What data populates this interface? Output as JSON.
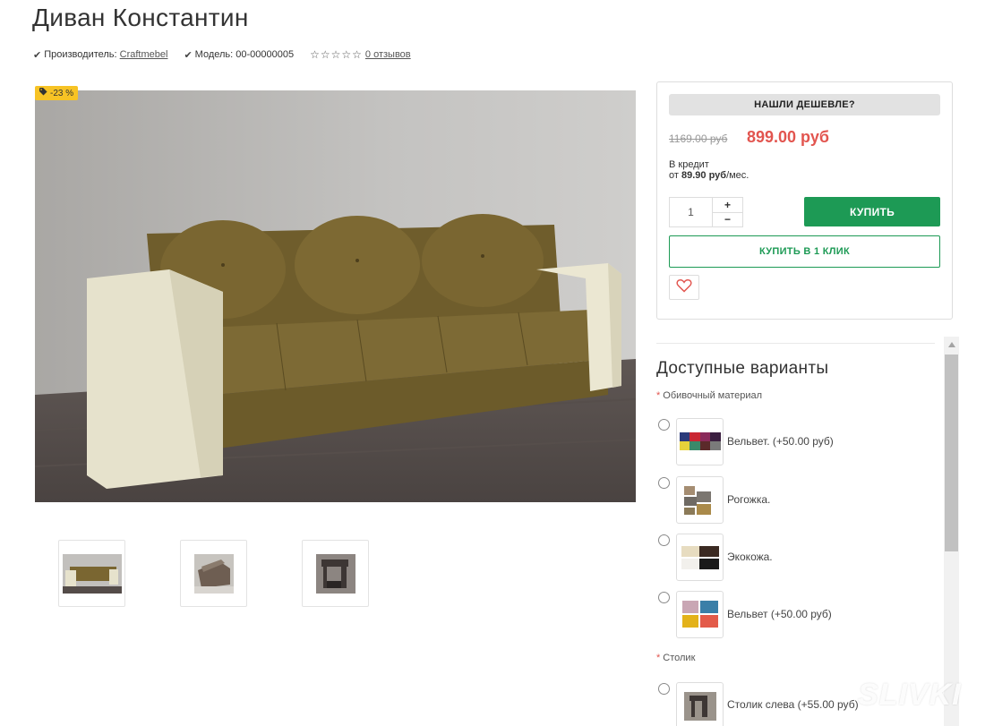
{
  "product": {
    "title": "Диван Константин",
    "manufacturer_label": "Производитель:",
    "manufacturer": "Craftmebel",
    "model_label": "Модель:",
    "model": "00-00000005",
    "rating": 0,
    "reviews_link": "0 отзывов"
  },
  "badge": {
    "text": "-23 %",
    "color": "#f7c325"
  },
  "buybox": {
    "cheaper_label": "НАШЛИ ДЕШЕВЛЕ?",
    "old_price": "1169.00 руб",
    "new_price": "899.00 руб",
    "credit_line1": "В кредит",
    "credit_prefix": "от",
    "credit_amount": "89.90 руб",
    "credit_suffix": "/мес.",
    "quantity": "1",
    "qty_plus": "+",
    "qty_minus": "−",
    "buy_label": "КУПИТЬ",
    "oneclick_label": "КУПИТЬ В 1 КЛИК",
    "accent_green": "#1d9a55",
    "price_red": "#e2554f"
  },
  "variants": {
    "title": "Доступные варианты",
    "groups": [
      {
        "label": "Обивочный материал",
        "options": [
          {
            "label": "Вельвет. (+50.00 руб)",
            "icon": "velvet-swatch"
          },
          {
            "label": "Рогожка.",
            "icon": "matting-swatch"
          },
          {
            "label": "Экокожа.",
            "icon": "eco-leather-swatch"
          },
          {
            "label": "Вельвет (+50.00 руб)",
            "icon": "velvet-swatch-2"
          }
        ]
      },
      {
        "label": "Столик",
        "options": [
          {
            "label": "Столик слева (+55.00 руб)",
            "icon": "table-left"
          }
        ]
      }
    ]
  },
  "watermark": "SLIVKI"
}
